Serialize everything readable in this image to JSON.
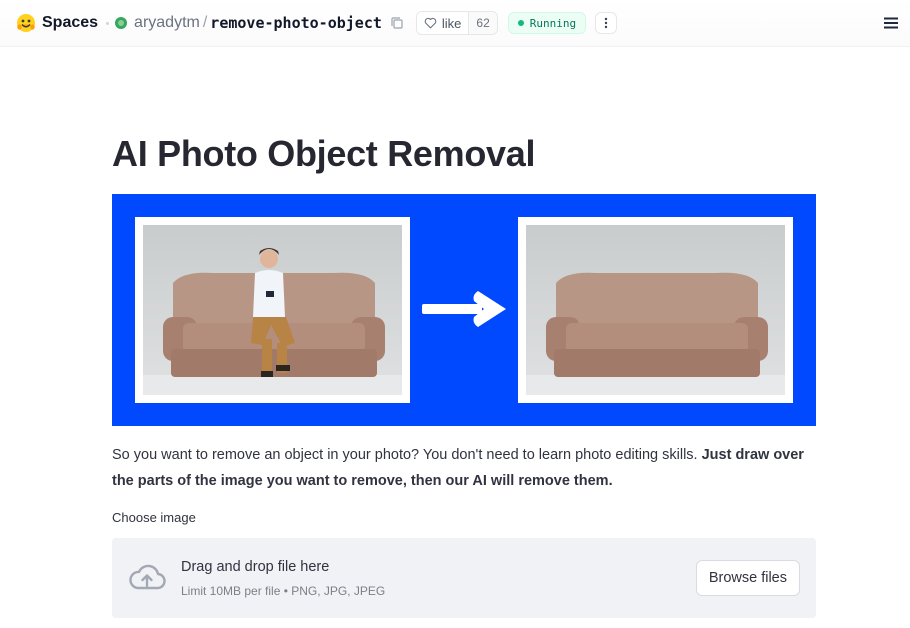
{
  "header": {
    "brand": "Spaces",
    "owner": "aryadytm",
    "separator": "/",
    "repo": "remove-photo-object",
    "like_label": "like",
    "like_count": "62",
    "status": "Running",
    "status_color": "#10b981"
  },
  "main": {
    "title": "AI Photo Object Removal",
    "hero_bg_color": "#0049ff",
    "description_plain": "So you want to remove an object in your photo? You don't need to learn photo editing skills. ",
    "description_bold": "Just draw over the parts of the image you want to remove, then our AI will remove them.",
    "uploader": {
      "label": "Choose image",
      "drop_title": "Drag and drop file here",
      "drop_limit": "Limit 10MB per file • PNG, JPG, JPEG",
      "browse_label": "Browse files"
    }
  },
  "icons": {
    "logo": "hugging-face-logo",
    "copy": "copy-icon",
    "like": "heart-icon",
    "more": "vertical-dots-icon",
    "menu": "hamburger-icon",
    "arrow": "right-arrow-icon",
    "upload": "cloud-upload-icon"
  }
}
